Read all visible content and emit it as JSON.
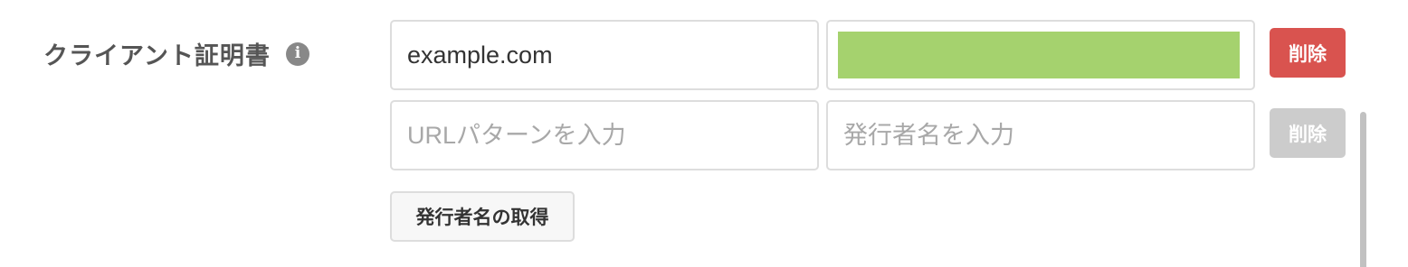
{
  "section": {
    "label": "クライアント証明書",
    "info_icon_glyph": "i"
  },
  "rows": [
    {
      "url_value": "example.com",
      "url_placeholder": "URLパターンを入力",
      "issuer_value": "",
      "issuer_masked_color": "#a5d26e",
      "delete_label": "削除",
      "delete_enabled": true
    },
    {
      "url_value": "",
      "url_placeholder": "URLパターンを入力",
      "issuer_value": "",
      "issuer_placeholder": "発行者名を入力",
      "delete_label": "削除",
      "delete_enabled": false
    }
  ],
  "fetch_issuer_button": {
    "label": "発行者名の取得"
  },
  "colors": {
    "delete_active": "#d9534f",
    "delete_disabled": "#cccccc"
  }
}
